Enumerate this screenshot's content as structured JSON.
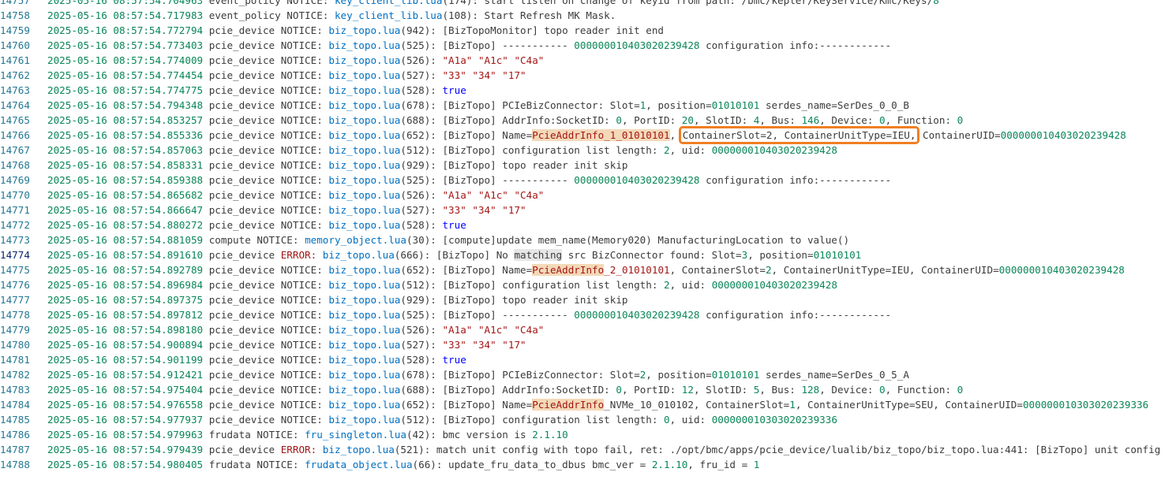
{
  "log_lines": [
    {
      "n": "14757",
      "c": [
        [
          "ts",
          "2025-05-16 08:57:54.704963"
        ],
        [
          "p",
          " event_policy "
        ],
        [
          "p",
          "NOTICE: "
        ],
        [
          "lnk",
          "key_client_lib.lua"
        ],
        [
          "p",
          "(174): start listen on change of keyid from path: /bmc/kepler/KeyService/Kmc/Keys/"
        ],
        [
          "num",
          "8"
        ]
      ]
    },
    {
      "n": "14758",
      "c": [
        [
          "ts",
          "2025-05-16 08:57:54.717983"
        ],
        [
          "p",
          " event_policy "
        ],
        [
          "p",
          "NOTICE: "
        ],
        [
          "lnk",
          "key_client_lib.lua"
        ],
        [
          "p",
          "(108): Start Refresh MK Mask."
        ]
      ]
    },
    {
      "n": "14759",
      "c": [
        [
          "ts",
          "2025-05-16 08:57:54.772794"
        ],
        [
          "p",
          " pcie_device "
        ],
        [
          "p",
          "NOTICE: "
        ],
        [
          "lnk",
          "biz_topo.lua"
        ],
        [
          "p",
          "(942): [BizTopoMonitor] topo reader init end"
        ]
      ]
    },
    {
      "n": "14760",
      "c": [
        [
          "ts",
          "2025-05-16 08:57:54.773403"
        ],
        [
          "p",
          " pcie_device "
        ],
        [
          "p",
          "NOTICE: "
        ],
        [
          "lnk",
          "biz_topo.lua"
        ],
        [
          "p",
          "(525): [BizTopo] ----------- "
        ],
        [
          "num",
          "000000010403020239428"
        ],
        [
          "p",
          " configuration info:------------"
        ]
      ]
    },
    {
      "n": "14761",
      "c": [
        [
          "ts",
          "2025-05-16 08:57:54.774009"
        ],
        [
          "p",
          " pcie_device "
        ],
        [
          "p",
          "NOTICE: "
        ],
        [
          "lnk",
          "biz_topo.lua"
        ],
        [
          "p",
          "(526): "
        ],
        [
          "str",
          "\"A1a\" \"A1c\" \"C4a\""
        ]
      ]
    },
    {
      "n": "14762",
      "c": [
        [
          "ts",
          "2025-05-16 08:57:54.774454"
        ],
        [
          "p",
          " pcie_device "
        ],
        [
          "p",
          "NOTICE: "
        ],
        [
          "lnk",
          "biz_topo.lua"
        ],
        [
          "p",
          "(527): "
        ],
        [
          "str",
          "\"33\" \"34\" \"17\""
        ]
      ]
    },
    {
      "n": "14763",
      "c": [
        [
          "ts",
          "2025-05-16 08:57:54.774775"
        ],
        [
          "p",
          " pcie_device "
        ],
        [
          "p",
          "NOTICE: "
        ],
        [
          "lnk",
          "biz_topo.lua"
        ],
        [
          "p",
          "(528): "
        ],
        [
          "kw",
          "true"
        ]
      ]
    },
    {
      "n": "14764",
      "c": [
        [
          "ts",
          "2025-05-16 08:57:54.794348"
        ],
        [
          "p",
          " pcie_device "
        ],
        [
          "p",
          "NOTICE: "
        ],
        [
          "lnk",
          "biz_topo.lua"
        ],
        [
          "p",
          "(678): [BizTopo] PCIeBizConnector: Slot="
        ],
        [
          "num",
          "1"
        ],
        [
          "p",
          ", position="
        ],
        [
          "num",
          "01010101"
        ],
        [
          "p",
          " serdes_name=SerDes_0_0_B"
        ]
      ]
    },
    {
      "n": "14765",
      "c": [
        [
          "ts",
          "2025-05-16 08:57:54.853257"
        ],
        [
          "p",
          " pcie_device "
        ],
        [
          "p",
          "NOTICE: "
        ],
        [
          "lnk",
          "biz_topo.lua"
        ],
        [
          "p",
          "(688): [BizTopo] AddrInfo:SocketID: "
        ],
        [
          "num",
          "0"
        ],
        [
          "p",
          ", PortID: "
        ],
        [
          "num",
          "20"
        ],
        [
          "p",
          ", SlotID: "
        ],
        [
          "num",
          "4"
        ],
        [
          "p",
          ", Bus: "
        ],
        [
          "num",
          "146"
        ],
        [
          "p",
          ", Device: "
        ],
        [
          "num",
          "0"
        ],
        [
          "p",
          ", Function: "
        ],
        [
          "num",
          "0"
        ]
      ]
    },
    {
      "n": "14766",
      "c": [
        [
          "ts",
          "2025-05-16 08:57:54.855336"
        ],
        [
          "p",
          " pcie_device "
        ],
        [
          "p",
          "NOTICE: "
        ],
        [
          "lnk",
          "biz_topo.lua"
        ],
        [
          "p",
          "(652): [BizTopo] Name="
        ],
        [
          "hl",
          "PcieAddrInfo_1_01010101"
        ],
        [
          "p",
          ", "
        ],
        [
          "box",
          "ContainerSlot=2, ContainerUnitType=IEU,"
        ],
        [
          "p",
          " ContainerUID="
        ],
        [
          "num",
          "000000010403020239428"
        ]
      ]
    },
    {
      "n": "14767",
      "c": [
        [
          "ts",
          "2025-05-16 08:57:54.857063"
        ],
        [
          "p",
          " pcie_device "
        ],
        [
          "p",
          "NOTICE: "
        ],
        [
          "lnk",
          "biz_topo.lua"
        ],
        [
          "p",
          "(512): [BizTopo] configuration list length: "
        ],
        [
          "num",
          "2"
        ],
        [
          "p",
          ", uid: "
        ],
        [
          "num",
          "000000010403020239428"
        ]
      ]
    },
    {
      "n": "14768",
      "c": [
        [
          "ts",
          "2025-05-16 08:57:54.858331"
        ],
        [
          "p",
          " pcie_device "
        ],
        [
          "p",
          "NOTICE: "
        ],
        [
          "lnk",
          "biz_topo.lua"
        ],
        [
          "p",
          "(929): [BizTopo] topo reader init skip"
        ]
      ]
    },
    {
      "n": "14769",
      "c": [
        [
          "ts",
          "2025-05-16 08:57:54.859388"
        ],
        [
          "p",
          " pcie_device "
        ],
        [
          "p",
          "NOTICE: "
        ],
        [
          "lnk",
          "biz_topo.lua"
        ],
        [
          "p",
          "(525): [BizTopo] ----------- "
        ],
        [
          "num",
          "000000010403020239428"
        ],
        [
          "p",
          " configuration info:------------"
        ]
      ]
    },
    {
      "n": "14770",
      "c": [
        [
          "ts",
          "2025-05-16 08:57:54.865682"
        ],
        [
          "p",
          " pcie_device "
        ],
        [
          "p",
          "NOTICE: "
        ],
        [
          "lnk",
          "biz_topo.lua"
        ],
        [
          "p",
          "(526): "
        ],
        [
          "str",
          "\"A1a\" \"A1c\" \"C4a\""
        ]
      ]
    },
    {
      "n": "14771",
      "c": [
        [
          "ts",
          "2025-05-16 08:57:54.866647"
        ],
        [
          "p",
          " pcie_device "
        ],
        [
          "p",
          "NOTICE: "
        ],
        [
          "lnk",
          "biz_topo.lua"
        ],
        [
          "p",
          "(527): "
        ],
        [
          "str",
          "\"33\" \"34\" \"17\""
        ]
      ]
    },
    {
      "n": "14772",
      "c": [
        [
          "ts",
          "2025-05-16 08:57:54.880272"
        ],
        [
          "p",
          " pcie_device "
        ],
        [
          "p",
          "NOTICE: "
        ],
        [
          "lnk",
          "biz_topo.lua"
        ],
        [
          "p",
          "(528): "
        ],
        [
          "kw",
          "true"
        ]
      ]
    },
    {
      "n": "14773",
      "c": [
        [
          "ts",
          "2025-05-16 08:57:54.881059"
        ],
        [
          "p",
          " compute "
        ],
        [
          "p",
          "NOTICE: "
        ],
        [
          "lnk",
          "memory_object.lua"
        ],
        [
          "p",
          "(30): [compute]update mem_name(Memory020) ManufacturingLocation to value()"
        ]
      ]
    },
    {
      "n": "14774",
      "cur": true,
      "c": [
        [
          "ts",
          "2025-05-16 08:57:54.891610"
        ],
        [
          "p",
          " pcie_device "
        ],
        [
          "err",
          "ERROR: "
        ],
        [
          "lnk",
          "biz_topo.lua"
        ],
        [
          "p",
          "(666): [BizTopo] No "
        ],
        [
          "wh",
          "matching"
        ],
        [
          "p",
          " src BizConnector found: Slot="
        ],
        [
          "num",
          "3"
        ],
        [
          "p",
          ", position="
        ],
        [
          "num",
          "01010101"
        ]
      ]
    },
    {
      "n": "14775",
      "c": [
        [
          "ts",
          "2025-05-16 08:57:54.892789"
        ],
        [
          "p",
          " pcie_device "
        ],
        [
          "p",
          "NOTICE: "
        ],
        [
          "lnk",
          "biz_topo.lua"
        ],
        [
          "p",
          "(652): [BizTopo] Name="
        ],
        [
          "hl",
          "PcieAddrInfo"
        ],
        [
          "hlt",
          "_2_01010101"
        ],
        [
          "p",
          ", ContainerSlot="
        ],
        [
          "num",
          "2"
        ],
        [
          "p",
          ", ContainerUnitType=IEU, ContainerUID="
        ],
        [
          "num",
          "000000010403020239428"
        ]
      ]
    },
    {
      "n": "14776",
      "c": [
        [
          "ts",
          "2025-05-16 08:57:54.896984"
        ],
        [
          "p",
          " pcie_device "
        ],
        [
          "p",
          "NOTICE: "
        ],
        [
          "lnk",
          "biz_topo.lua"
        ],
        [
          "p",
          "(512): [BizTopo] configuration list length: "
        ],
        [
          "num",
          "2"
        ],
        [
          "p",
          ", uid: "
        ],
        [
          "num",
          "000000010403020239428"
        ]
      ]
    },
    {
      "n": "14777",
      "c": [
        [
          "ts",
          "2025-05-16 08:57:54.897375"
        ],
        [
          "p",
          " pcie_device "
        ],
        [
          "p",
          "NOTICE: "
        ],
        [
          "lnk",
          "biz_topo.lua"
        ],
        [
          "p",
          "(929): [BizTopo] topo reader init skip"
        ]
      ]
    },
    {
      "n": "14778",
      "c": [
        [
          "ts",
          "2025-05-16 08:57:54.897812"
        ],
        [
          "p",
          " pcie_device "
        ],
        [
          "p",
          "NOTICE: "
        ],
        [
          "lnk",
          "biz_topo.lua"
        ],
        [
          "p",
          "(525): [BizTopo] ----------- "
        ],
        [
          "num",
          "000000010403020239428"
        ],
        [
          "p",
          " configuration info:------------"
        ]
      ]
    },
    {
      "n": "14779",
      "c": [
        [
          "ts",
          "2025-05-16 08:57:54.898180"
        ],
        [
          "p",
          " pcie_device "
        ],
        [
          "p",
          "NOTICE: "
        ],
        [
          "lnk",
          "biz_topo.lua"
        ],
        [
          "p",
          "(526): "
        ],
        [
          "str",
          "\"A1a\" \"A1c\" \"C4a\""
        ]
      ]
    },
    {
      "n": "14780",
      "c": [
        [
          "ts",
          "2025-05-16 08:57:54.900894"
        ],
        [
          "p",
          " pcie_device "
        ],
        [
          "p",
          "NOTICE: "
        ],
        [
          "lnk",
          "biz_topo.lua"
        ],
        [
          "p",
          "(527): "
        ],
        [
          "str",
          "\"33\" \"34\" \"17\""
        ]
      ]
    },
    {
      "n": "14781",
      "c": [
        [
          "ts",
          "2025-05-16 08:57:54.901199"
        ],
        [
          "p",
          " pcie_device "
        ],
        [
          "p",
          "NOTICE: "
        ],
        [
          "lnk",
          "biz_topo.lua"
        ],
        [
          "p",
          "(528): "
        ],
        [
          "kw",
          "true"
        ]
      ]
    },
    {
      "n": "14782",
      "c": [
        [
          "ts",
          "2025-05-16 08:57:54.912421"
        ],
        [
          "p",
          " pcie_device "
        ],
        [
          "p",
          "NOTICE: "
        ],
        [
          "lnk",
          "biz_topo.lua"
        ],
        [
          "p",
          "(678): [BizTopo] PCIeBizConnector: Slot="
        ],
        [
          "num",
          "2"
        ],
        [
          "p",
          ", position="
        ],
        [
          "num",
          "01010101"
        ],
        [
          "p",
          " serdes_name=SerDes_0_5_A"
        ]
      ]
    },
    {
      "n": "14783",
      "c": [
        [
          "ts",
          "2025-05-16 08:57:54.975404"
        ],
        [
          "p",
          " pcie_device "
        ],
        [
          "p",
          "NOTICE: "
        ],
        [
          "lnk",
          "biz_topo.lua"
        ],
        [
          "p",
          "(688): [BizTopo] AddrInfo:SocketID: "
        ],
        [
          "num",
          "0"
        ],
        [
          "p",
          ", PortID: "
        ],
        [
          "num",
          "12"
        ],
        [
          "p",
          ", SlotID: "
        ],
        [
          "num",
          "5"
        ],
        [
          "p",
          ", Bus: "
        ],
        [
          "num",
          "128"
        ],
        [
          "p",
          ", Device: "
        ],
        [
          "num",
          "0"
        ],
        [
          "p",
          ", Function: "
        ],
        [
          "num",
          "0"
        ]
      ]
    },
    {
      "n": "14784",
      "c": [
        [
          "ts",
          "2025-05-16 08:57:54.976558"
        ],
        [
          "p",
          " pcie_device "
        ],
        [
          "p",
          "NOTICE: "
        ],
        [
          "lnk",
          "biz_topo.lua"
        ],
        [
          "p",
          "(652): [BizTopo] Name="
        ],
        [
          "hl",
          "PcieAddrInfo"
        ],
        [
          "p",
          "_NVMe_10_010102, ContainerSlot="
        ],
        [
          "num",
          "1"
        ],
        [
          "p",
          ", ContainerUnitType=SEU, ContainerUID="
        ],
        [
          "num",
          "000000010303020239336"
        ]
      ]
    },
    {
      "n": "14785",
      "c": [
        [
          "ts",
          "2025-05-16 08:57:54.977937"
        ],
        [
          "p",
          " pcie_device "
        ],
        [
          "p",
          "NOTICE: "
        ],
        [
          "lnk",
          "biz_topo.lua"
        ],
        [
          "p",
          "(512): [BizTopo] configuration list length: "
        ],
        [
          "num",
          "0"
        ],
        [
          "p",
          ", uid: "
        ],
        [
          "num",
          "000000010303020239336"
        ]
      ]
    },
    {
      "n": "14786",
      "c": [
        [
          "ts",
          "2025-05-16 08:57:54.979963"
        ],
        [
          "p",
          " frudata "
        ],
        [
          "p",
          "NOTICE: "
        ],
        [
          "lnk",
          "fru_singleton.lua"
        ],
        [
          "p",
          "(42): bmc version is "
        ],
        [
          "num",
          "2.1.10"
        ]
      ]
    },
    {
      "n": "14787",
      "c": [
        [
          "ts",
          "2025-05-16 08:57:54.979439"
        ],
        [
          "p",
          " pcie_device "
        ],
        [
          "err",
          "ERROR: "
        ],
        [
          "lnk",
          "biz_topo.lua"
        ],
        [
          "p",
          "(521): match unit config with topo fail, ret: ./opt/bmc/apps/pcie_device/lualib/biz_topo/biz_topo.lua:441: [BizTopo] unit config"
        ]
      ]
    },
    {
      "n": "14788",
      "c": [
        [
          "ts",
          "2025-05-16 08:57:54.980405"
        ],
        [
          "p",
          " frudata "
        ],
        [
          "p",
          "NOTICE: "
        ],
        [
          "lnk",
          "frudata_object.lua"
        ],
        [
          "p",
          "(66): update_fru_data_to_dbus bmc_ver = "
        ],
        [
          "num",
          "2.1.10"
        ],
        [
          "p",
          ", fru_id = "
        ],
        [
          "num",
          "1"
        ]
      ]
    }
  ],
  "colors": {
    "timestamp": "#098658",
    "link": "#0070c1",
    "error": "#a31515",
    "highlight_bg": "#f3d9b8",
    "box": "#f07f23"
  }
}
